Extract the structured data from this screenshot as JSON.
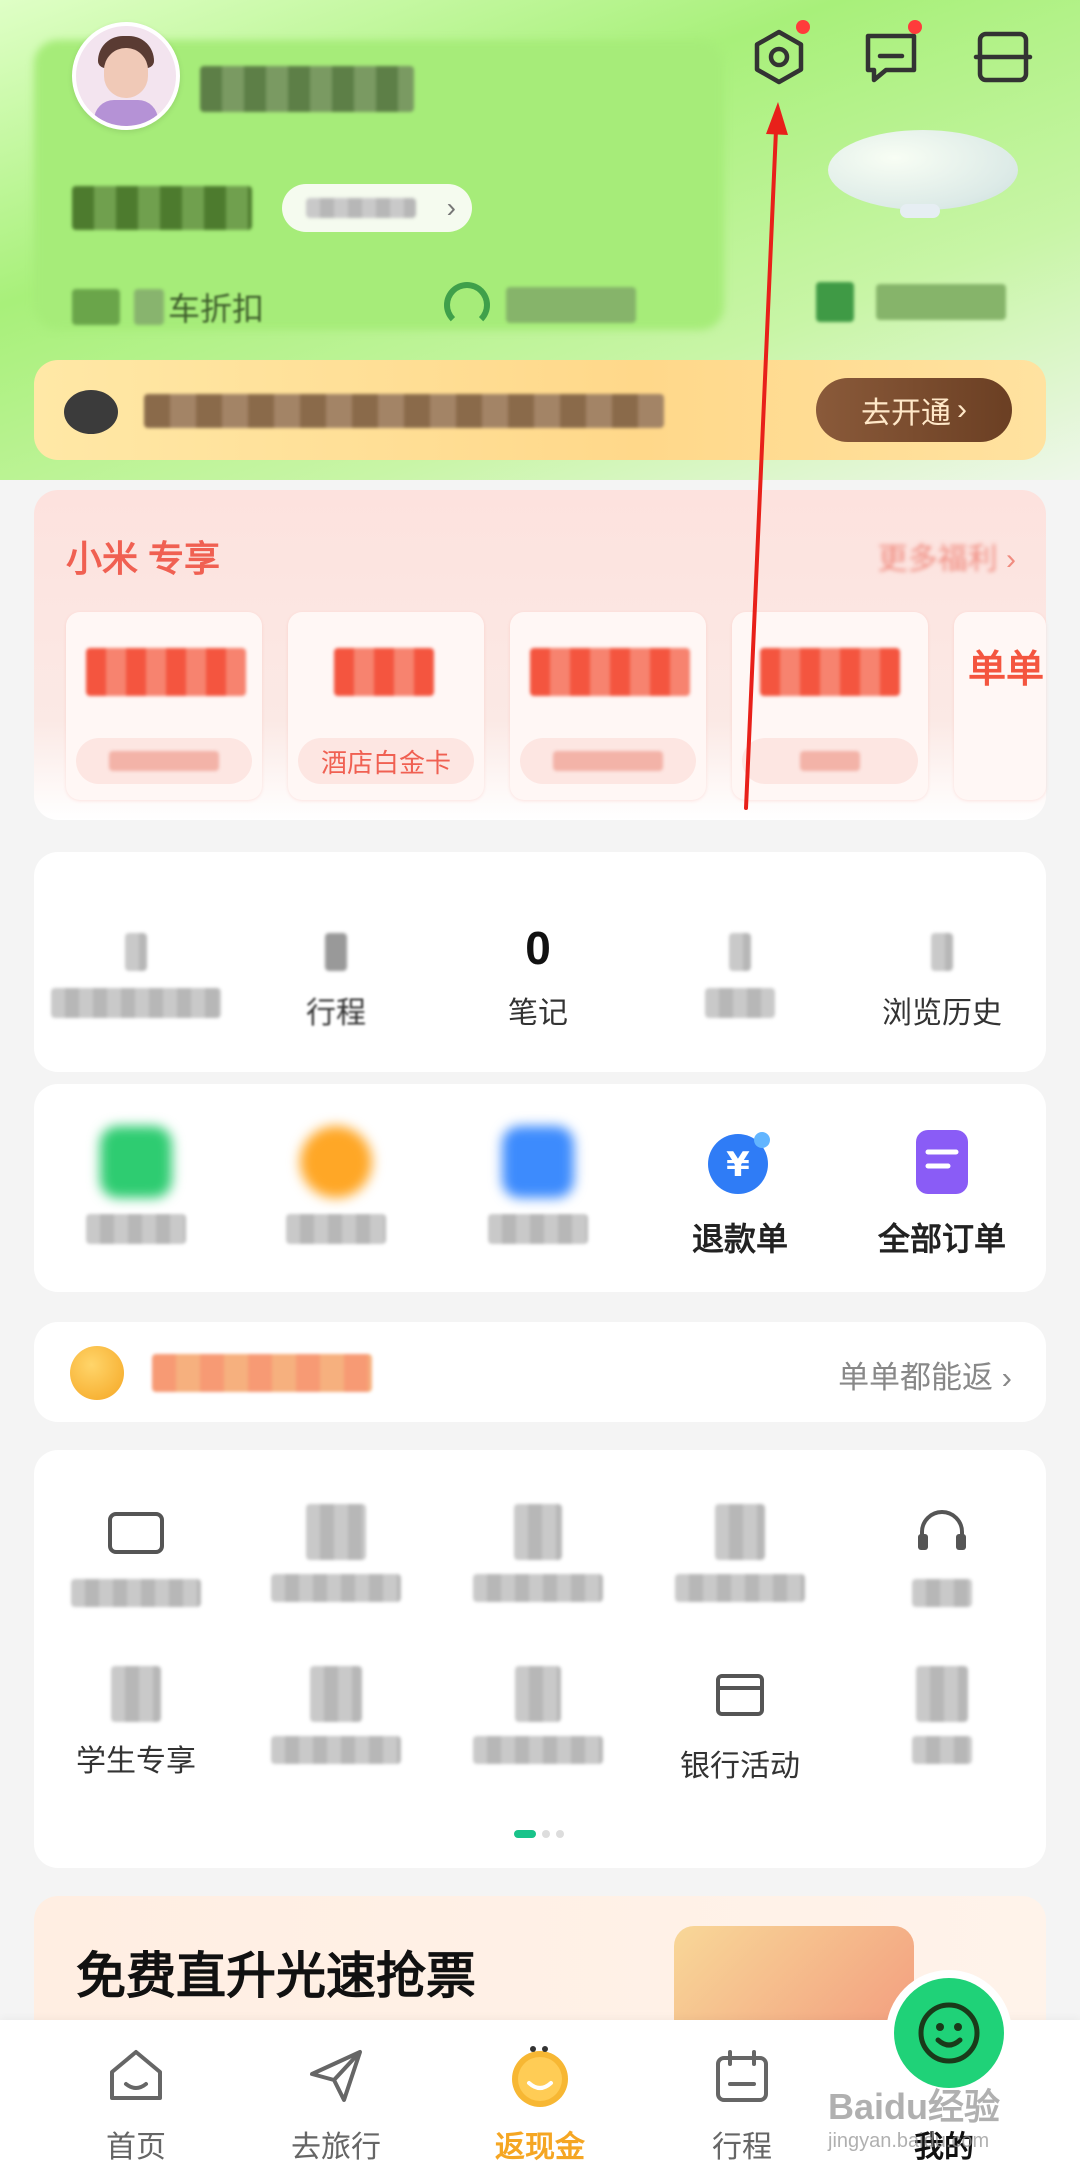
{
  "header": {
    "username": "",
    "member_level": "",
    "member_tag": "",
    "quick_links": [
      "车折扣",
      "",
      ""
    ],
    "settings_badge": true,
    "messages_badge": true
  },
  "vip_bar": {
    "text": "",
    "button_label": "去开通"
  },
  "promo": {
    "title": "小米  专享",
    "more": "更多福利",
    "coupons": [
      {
        "amount": "",
        "sub": ""
      },
      {
        "amount": "",
        "sub": "酒店白金卡"
      },
      {
        "amount": "",
        "sub": ""
      },
      {
        "amount": "",
        "sub": ""
      },
      {
        "amount": "单单",
        "sub": ""
      }
    ]
  },
  "stats": [
    {
      "value": "",
      "label": ""
    },
    {
      "value": "",
      "label": "行程"
    },
    {
      "value": "0",
      "label": "笔记"
    },
    {
      "value": "",
      "label": ""
    },
    {
      "value": "",
      "label": "浏览历史"
    }
  ],
  "orders": [
    {
      "label": "待出行",
      "icon": "ticket-green-icon",
      "color": "#2ecc71"
    },
    {
      "label": "待出行",
      "icon": "coin-orange-icon",
      "color": "#ffa726"
    },
    {
      "label": "待点评",
      "icon": "comment-blue-icon",
      "color": "#3d8bfd"
    },
    {
      "label": "退款单",
      "icon": "yuan-refund-icon",
      "color": "#2f7cf6"
    },
    {
      "label": "全部订单",
      "icon": "order-list-icon",
      "color": "#8a5cf6"
    }
  ],
  "cashback": {
    "text": "",
    "more": "单单都能返"
  },
  "tools": [
    {
      "label": "",
      "icon": "card-icon"
    },
    {
      "label": "",
      "icon": "wallet-icon"
    },
    {
      "label": "",
      "icon": "document-icon"
    },
    {
      "label": "",
      "icon": "person-icon"
    },
    {
      "label": "",
      "icon": "headset-icon"
    },
    {
      "label": "学生专享",
      "icon": "student-icon"
    },
    {
      "label": "",
      "icon": "lamp-icon"
    },
    {
      "label": "",
      "icon": "bag-icon"
    },
    {
      "label": "银行活动",
      "icon": "bank-icon"
    },
    {
      "label": "",
      "icon": "gift-icon"
    }
  ],
  "ticket_banner": {
    "title": "免费直升光速抢票"
  },
  "tabbar": [
    {
      "label": "首页",
      "icon": "home-icon"
    },
    {
      "label": "去旅行",
      "icon": "paper-plane-icon"
    },
    {
      "label": "返现金",
      "icon": "cashback-smile-icon"
    },
    {
      "label": "行程",
      "icon": "calendar-icon"
    },
    {
      "label": "我的",
      "icon": "profile-smile-icon"
    }
  ],
  "watermark": {
    "text": "Baidu经验",
    "sub": "jingyan.baidu.com"
  }
}
